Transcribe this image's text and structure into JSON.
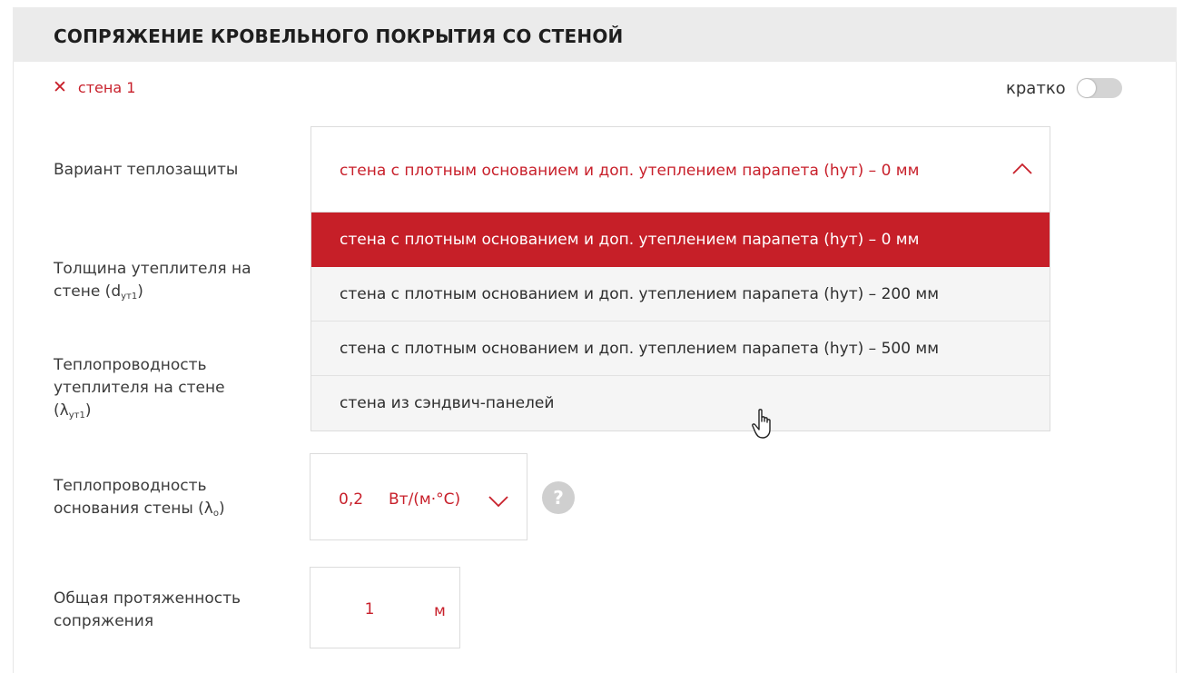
{
  "header": {
    "title": "СОПРЯЖЕНИЕ КРОВЕЛЬНОГО ПОКРЫТИЯ СО СТЕНОЙ"
  },
  "wall": {
    "close_icon": "close-icon",
    "label": "стена 1"
  },
  "brief_toggle": {
    "label": "кратко",
    "on": false
  },
  "thermal_protection": {
    "label": "Вариант теплозащиты",
    "selected": "стена с плотным основанием и доп. утеплением парапета (hут) – 0 мм",
    "options": [
      "стена с плотным основанием и доп. утеплением парапета (hут) – 0 мм",
      "стена с плотным основанием и доп. утеплением парапета (hут) – 200 мм",
      "стена с плотным основанием и доп. утеплением парапета (hут) – 500 мм",
      "стена из сэндвич-панелей"
    ]
  },
  "insulation_thickness": {
    "label_line1": "Толщина утеплителя на",
    "label_line2": "стене (d",
    "label_sub": "ут1",
    "label_end": ")"
  },
  "insulation_conductivity": {
    "label_line1": "Теплопроводность",
    "label_line2": "утеплителя на стене",
    "label_line3": "(λ",
    "label_sub": "ут1",
    "label_end": ")"
  },
  "base_conductivity": {
    "label_line1": "Теплопроводность",
    "label_line2": "основания стены (λ",
    "label_sub": "о",
    "label_end": ")",
    "value": "0,2",
    "unit": "Вт/(м·°С)",
    "help": "?"
  },
  "junction_length": {
    "label_line1": "Общая протяженность",
    "label_line2": "сопряжения",
    "value": "1",
    "unit": "м"
  },
  "colors": {
    "accent": "#c61f28",
    "header_bg": "#ebebeb",
    "toggle_off": "#d4d4d4"
  }
}
